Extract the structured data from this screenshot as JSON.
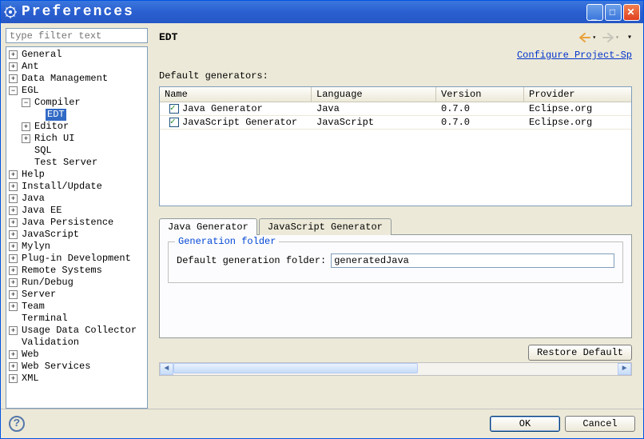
{
  "window": {
    "title": "Preferences"
  },
  "filter": {
    "placeholder": "type filter text"
  },
  "tree": [
    {
      "label": "General",
      "expander": "plus"
    },
    {
      "label": "Ant",
      "expander": "plus"
    },
    {
      "label": "Data Management",
      "expander": "plus"
    },
    {
      "label": "EGL",
      "expander": "minus",
      "children": [
        {
          "label": "Compiler",
          "expander": "minus",
          "children": [
            {
              "label": "EDT",
              "expander": "blank",
              "selected": true
            }
          ]
        },
        {
          "label": "Editor",
          "expander": "plus"
        },
        {
          "label": "Rich UI",
          "expander": "plus"
        },
        {
          "label": "SQL",
          "expander": "blank"
        },
        {
          "label": "Test Server",
          "expander": "blank"
        }
      ]
    },
    {
      "label": "Help",
      "expander": "plus"
    },
    {
      "label": "Install/Update",
      "expander": "plus"
    },
    {
      "label": "Java",
      "expander": "plus"
    },
    {
      "label": "Java EE",
      "expander": "plus"
    },
    {
      "label": "Java Persistence",
      "expander": "plus"
    },
    {
      "label": "JavaScript",
      "expander": "plus"
    },
    {
      "label": "Mylyn",
      "expander": "plus"
    },
    {
      "label": "Plug-in Development",
      "expander": "plus"
    },
    {
      "label": "Remote Systems",
      "expander": "plus"
    },
    {
      "label": "Run/Debug",
      "expander": "plus"
    },
    {
      "label": "Server",
      "expander": "plus"
    },
    {
      "label": "Team",
      "expander": "plus"
    },
    {
      "label": "Terminal",
      "expander": "blank"
    },
    {
      "label": "Usage Data Collector",
      "expander": "plus"
    },
    {
      "label": "Validation",
      "expander": "blank"
    },
    {
      "label": "Web",
      "expander": "plus"
    },
    {
      "label": "Web Services",
      "expander": "plus"
    },
    {
      "label": "XML",
      "expander": "plus"
    }
  ],
  "right": {
    "title": "EDT",
    "configure_link": "Configure Project-Sp",
    "section_label": "Default generators:",
    "columns": {
      "name": "Name",
      "language": "Language",
      "version": "Version",
      "provider": "Provider"
    },
    "rows": [
      {
        "checked": true,
        "name": "Java Generator",
        "language": "Java",
        "version": "0.7.0",
        "provider": "Eclipse.org"
      },
      {
        "checked": true,
        "name": "JavaScript Generator",
        "language": "JavaScript",
        "version": "0.7.0",
        "provider": "Eclipse.org"
      }
    ],
    "tabs": [
      {
        "label": "Java Generator",
        "active": true
      },
      {
        "label": "JavaScript Generator",
        "active": false
      }
    ],
    "fieldset": {
      "legend": "Generation folder",
      "field_label": "Default generation folder:",
      "field_value": "generatedJava"
    },
    "restore_label": "Restore Default"
  },
  "footer": {
    "ok": "OK",
    "cancel": "Cancel"
  }
}
